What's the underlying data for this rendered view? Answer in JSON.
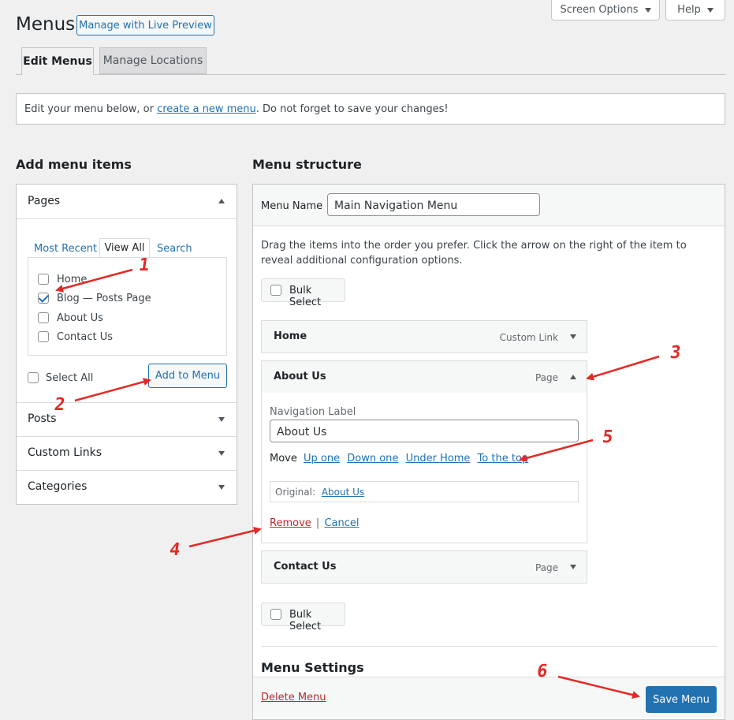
{
  "header": {
    "title": "Menus",
    "live_preview": "Manage with Live Preview",
    "screen_options": "Screen Options",
    "help": "Help"
  },
  "tabs": {
    "edit": "Edit Menus",
    "locations": "Manage Locations"
  },
  "notice": {
    "before": "Edit your menu below, or ",
    "link": "create a new menu",
    "after": ". Do not forget to save your changes!"
  },
  "add_items": {
    "heading": "Add menu items",
    "pages": {
      "title": "Pages",
      "tabs": [
        "Most Recent",
        "View All",
        "Search"
      ],
      "items": [
        {
          "label": "Home",
          "checked": false
        },
        {
          "label": "Blog — Posts Page",
          "checked": true
        },
        {
          "label": "About Us",
          "checked": false
        },
        {
          "label": "Contact Us",
          "checked": false
        }
      ],
      "select_all": "Select All",
      "add_button": "Add to Menu"
    },
    "sections": [
      "Posts",
      "Custom Links",
      "Categories"
    ]
  },
  "structure": {
    "heading": "Menu structure",
    "menu_name_label": "Menu Name",
    "menu_name_value": "Main Navigation Menu",
    "instructions": "Drag the items into the order you prefer. Click the arrow on the right of the item to reveal additional configuration options.",
    "bulk_select": "Bulk Select",
    "items": [
      {
        "title": "Home",
        "type": "Custom Link"
      },
      {
        "title": "About Us",
        "type": "Page"
      },
      {
        "title": "Contact Us",
        "type": "Page"
      }
    ],
    "expanded": {
      "nav_label_caption": "Navigation Label",
      "nav_label_value": "About Us",
      "move_label": "Move",
      "move_links": [
        "Up one",
        "Down one",
        "Under Home",
        "To the top"
      ],
      "original_label": "Original:",
      "original_link": "About Us",
      "remove": "Remove",
      "separator": "|",
      "cancel": "Cancel"
    },
    "settings_heading": "Menu Settings",
    "delete": "Delete Menu",
    "save": "Save Menu"
  },
  "annotations": [
    "1",
    "2",
    "3",
    "4",
    "5",
    "6"
  ],
  "colors": {
    "accent": "#2271b1",
    "annotation": "#e22a25",
    "danger": "#b32d2e"
  }
}
